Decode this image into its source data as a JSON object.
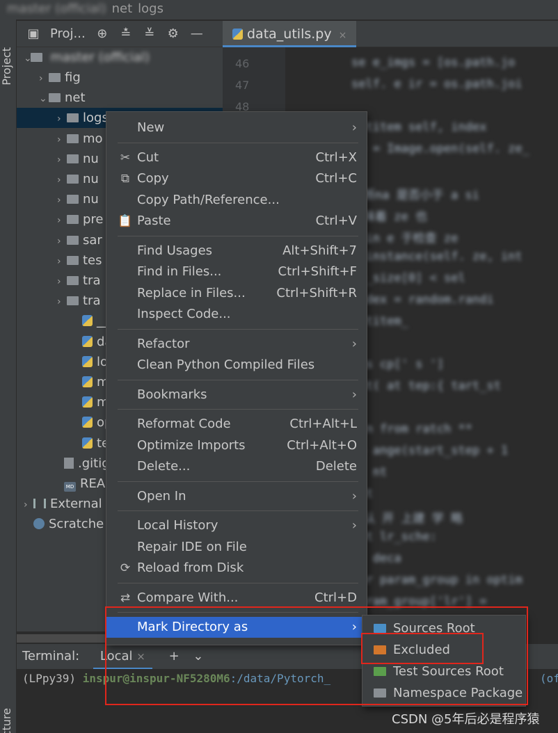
{
  "breadcrumb": [
    "master (official)",
    "net",
    "logs"
  ],
  "stripe": {
    "top": "Project",
    "bottom": "cture"
  },
  "project_panel": {
    "title": "Proj..."
  },
  "tree": [
    {
      "label": "fig",
      "chev": "›",
      "icon": "folder"
    },
    {
      "label": "net",
      "chev": "⌄",
      "icon": "folder"
    },
    {
      "label": "logs",
      "chev": "›",
      "icon": "folder",
      "selected": true
    },
    {
      "label": "mo",
      "chev": "›",
      "icon": "folder-special"
    },
    {
      "label": "nu",
      "chev": "›",
      "icon": "folder"
    },
    {
      "label": "nu",
      "chev": "›",
      "icon": "folder"
    },
    {
      "label": "nu",
      "chev": "›",
      "icon": "folder"
    },
    {
      "label": "pre",
      "chev": "›",
      "icon": "folder"
    },
    {
      "label": "sar",
      "chev": "›",
      "icon": "folder"
    },
    {
      "label": "tes",
      "chev": "›",
      "icon": "folder"
    },
    {
      "label": "tra",
      "chev": "›",
      "icon": "folder"
    },
    {
      "label": "tra",
      "chev": "›",
      "icon": "folder"
    },
    {
      "label": "__i",
      "chev": "",
      "icon": "python"
    },
    {
      "label": "da",
      "chev": "",
      "icon": "python"
    },
    {
      "label": "los",
      "chev": "",
      "icon": "python"
    },
    {
      "label": "ma",
      "chev": "",
      "icon": "python"
    },
    {
      "label": "me",
      "chev": "",
      "icon": "python"
    },
    {
      "label": "op",
      "chev": "",
      "icon": "python"
    },
    {
      "label": "tes",
      "chev": "",
      "icon": "python"
    },
    {
      "label": ".gitigr",
      "chev": "",
      "icon": "file"
    },
    {
      "label": "READ",
      "chev": "",
      "icon": "markdown"
    },
    {
      "label": "External",
      "chev": "›",
      "icon": "library"
    },
    {
      "label": "Scratche",
      "chev": "",
      "icon": "scratch"
    }
  ],
  "editor": {
    "tab_label": "data_utils.py",
    "line_numbers": [
      "46",
      "47",
      "48"
    ],
    "lines": [
      "se      e_imgs = [os.path.jo",
      "self.   e    ir = os.path.joi",
      "",
      "   getitem   self, index",
      "ze = Image.open(self.  ze_",
      "",
      "判断na    是否小于 a     si",
      "意味着      ze             也",
      "isin    e   于检查        ze",
      "   isinstance(self.   ze,  int",
      "      ze_size[0] < sel",
      "       index = random.randi",
      "getitem_",
      "",
      "ims   cp['  s  ']",
      "int(     at    tep:{ tart_st",
      "",
      "ain       from  ratch **",
      "ep     ange(start_step + 1",
      "t.     nt",
      "   opt",
      "默认  开   上建   学 略",
      " not      lr_sche:",
      "        sc           deca",
      "  for param_group in  optim",
      "         param_group['lr'] ="
    ]
  },
  "terminal": {
    "title": "Terminal:",
    "tab": "Local",
    "tab_close": "×",
    "add": "+",
    "dropdown": "⌄",
    "env": "(LPpy39)",
    "user_host": "inspur@inspur-NF5280M6",
    "path": ":/data/Pytorch_",
    "tail": "(of"
  },
  "menu": {
    "items": [
      {
        "label": "New",
        "shortcut": "",
        "submenu": true,
        "icon": ""
      },
      {
        "sep": true
      },
      {
        "label": "Cut",
        "shortcut": "Ctrl+X",
        "icon": "✂"
      },
      {
        "label": "Copy",
        "shortcut": "Ctrl+C",
        "icon": "⧉"
      },
      {
        "label": "Copy Path/Reference...",
        "shortcut": "",
        "icon": ""
      },
      {
        "label": "Paste",
        "shortcut": "Ctrl+V",
        "icon": "📋"
      },
      {
        "sep": true
      },
      {
        "label": "Find Usages",
        "shortcut": "Alt+Shift+7",
        "icon": ""
      },
      {
        "label": "Find in Files...",
        "shortcut": "Ctrl+Shift+F",
        "icon": ""
      },
      {
        "label": "Replace in Files...",
        "shortcut": "Ctrl+Shift+R",
        "icon": ""
      },
      {
        "label": "Inspect Code...",
        "shortcut": "",
        "icon": ""
      },
      {
        "sep": true
      },
      {
        "label": "Refactor",
        "shortcut": "",
        "submenu": true,
        "icon": ""
      },
      {
        "label": "Clean Python Compiled Files",
        "shortcut": "",
        "icon": ""
      },
      {
        "sep": true
      },
      {
        "label": "Bookmarks",
        "shortcut": "",
        "submenu": true,
        "icon": ""
      },
      {
        "sep": true
      },
      {
        "label": "Reformat Code",
        "shortcut": "Ctrl+Alt+L",
        "icon": ""
      },
      {
        "label": "Optimize Imports",
        "shortcut": "Ctrl+Alt+O",
        "icon": ""
      },
      {
        "label": "Delete...",
        "shortcut": "Delete",
        "icon": ""
      },
      {
        "sep": true
      },
      {
        "label": "Open In",
        "shortcut": "",
        "submenu": true,
        "icon": ""
      },
      {
        "sep": true
      },
      {
        "label": "Local History",
        "shortcut": "",
        "submenu": true,
        "icon": ""
      },
      {
        "label": "Repair IDE on File",
        "shortcut": "",
        "icon": ""
      },
      {
        "label": "Reload from Disk",
        "shortcut": "",
        "icon": "⟳"
      },
      {
        "sep": true
      },
      {
        "label": "Compare With...",
        "shortcut": "Ctrl+D",
        "icon": "⇄"
      },
      {
        "sep": true
      },
      {
        "label": "Mark Directory as",
        "shortcut": "",
        "submenu": true,
        "icon": "",
        "highlighted": true
      }
    ]
  },
  "submenu": {
    "items": [
      {
        "label": "Sources Root",
        "color": "#4a8fc7"
      },
      {
        "label": "Excluded",
        "color": "#d2762c"
      },
      {
        "label": "Test Sources Root",
        "color": "#5b9e4c"
      },
      {
        "label": "Namespace Package",
        "color": "#8a8f94"
      }
    ]
  },
  "watermark": "CSDN @5年后必是程序猿",
  "colors": {
    "accent": "#2f65ca",
    "annotation": "#e0261c",
    "background": "#2b2b2b",
    "panel": "#3c3f41"
  }
}
